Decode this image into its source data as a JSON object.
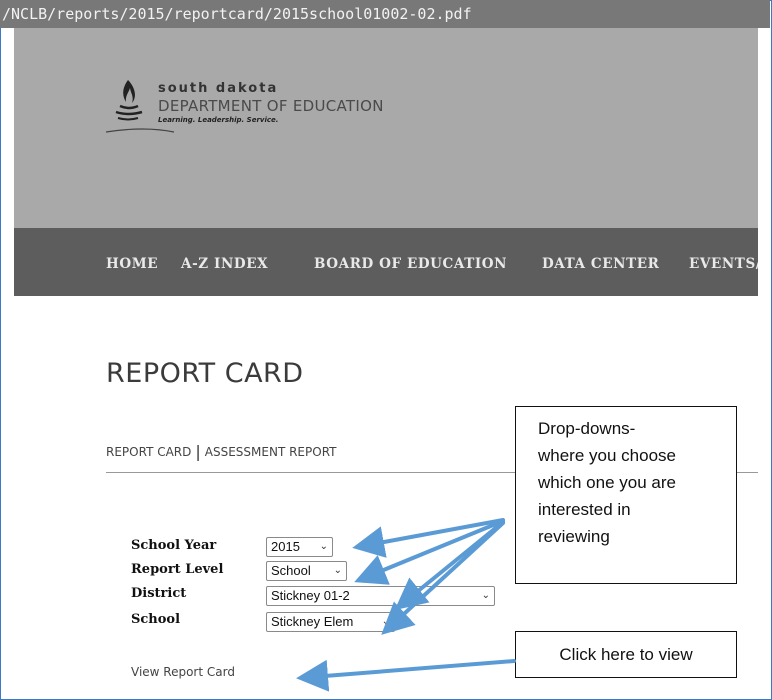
{
  "browser": {
    "url": "/NCLB/reports/2015/reportcard/2015school01002-02.pdf"
  },
  "header": {
    "logo_line1": "south dakota",
    "logo_line2": "DEPARTMENT OF EDUCATION",
    "logo_tagline": "Learning. Leadership. Service."
  },
  "nav": {
    "items": [
      {
        "label": "HOME"
      },
      {
        "label": "A-Z INDEX"
      },
      {
        "label": "BOARD OF EDUCATION"
      },
      {
        "label": "DATA CENTER"
      },
      {
        "label": "EVENTS/I"
      }
    ]
  },
  "page": {
    "title": "REPORT CARD",
    "subnav_report_card": "REPORT CARD",
    "subnav_separator": "|",
    "subnav_assessment": "ASSESSMENT REPORT"
  },
  "form": {
    "school_year_label": "School Year",
    "school_year_value": "2015",
    "report_level_label": "Report Level",
    "report_level_value": "School",
    "district_label": "District",
    "district_value": "Stickney 01-2",
    "school_label": "School",
    "school_value": "Stickney Elem",
    "view_link": "View Report Card"
  },
  "annotations": {
    "dropdown_note_lines": [
      "Drop-downs-",
      "where you choose",
      "which one you are",
      "interested in",
      "reviewing"
    ],
    "view_note": "Click here to view"
  },
  "colors": {
    "url_bar": "#787878",
    "banner": "#a9a9a9",
    "navbar": "#5d5d5d",
    "arrow": "#5b9bd5",
    "frame": "#3d79c4"
  }
}
